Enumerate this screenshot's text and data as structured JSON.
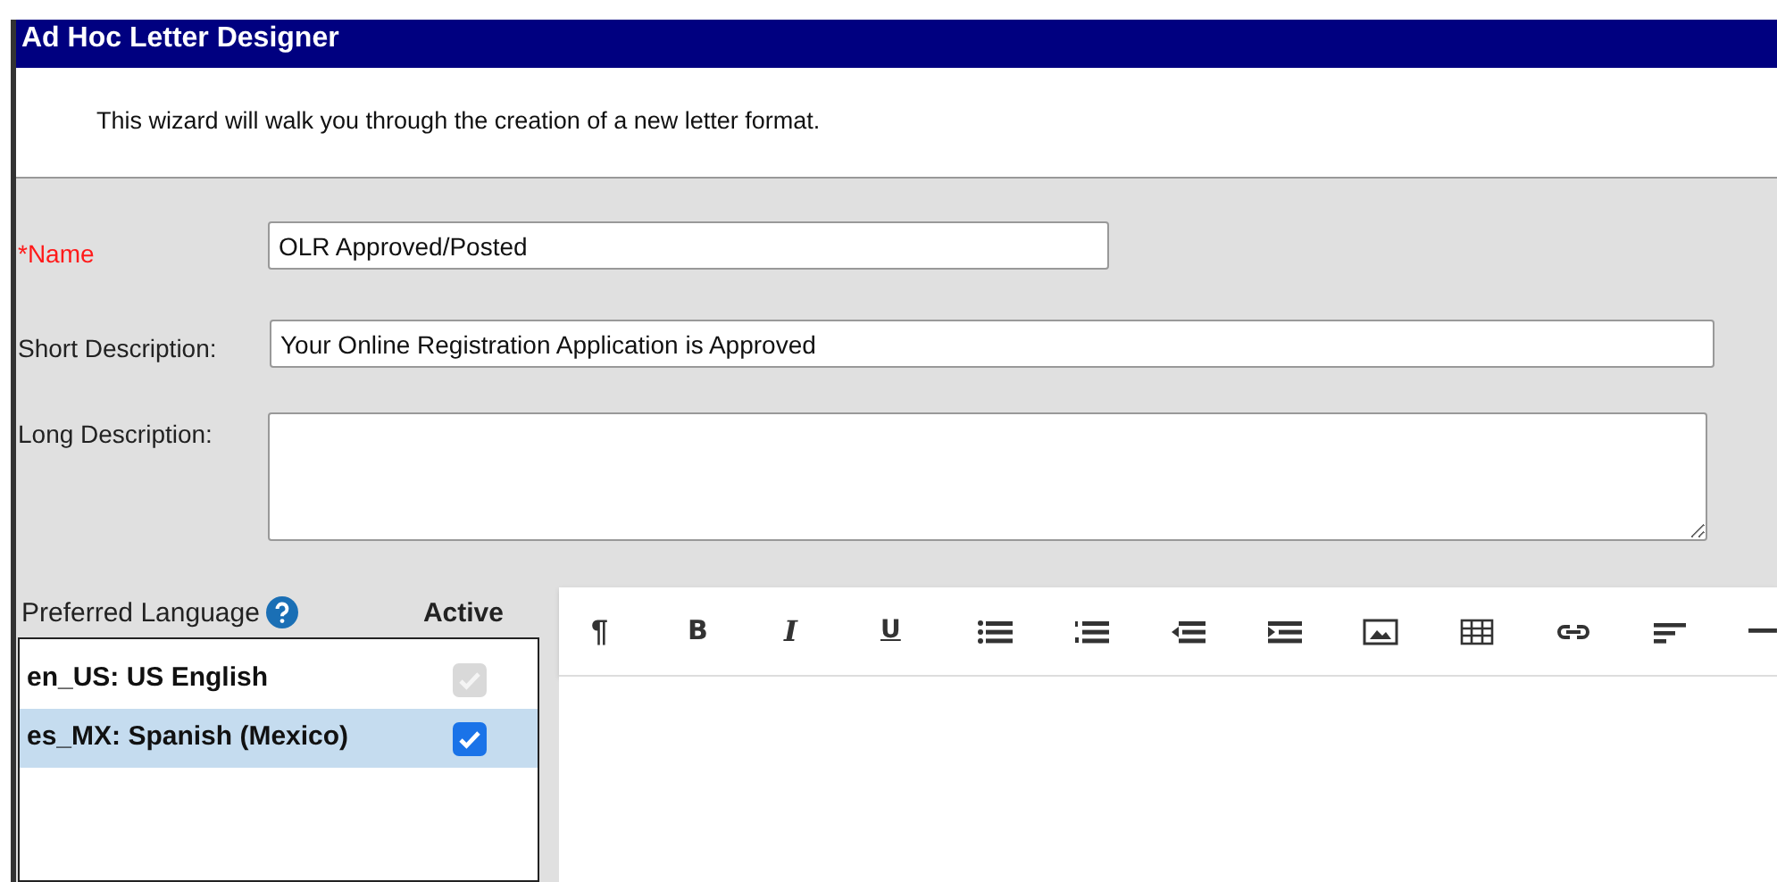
{
  "window": {
    "title": "Ad Hoc Letter Designer"
  },
  "intro": "This wizard will walk you through the creation of a new letter format.",
  "fields": [
    {
      "label": "*Name",
      "required": true,
      "kind": "input",
      "value": "OLR Approved/Posted"
    },
    {
      "label": "Short Description:",
      "required": false,
      "kind": "input",
      "value": "Your Online Registration Application is Approved"
    },
    {
      "label": "Long Description:",
      "required": false,
      "kind": "textarea"
    }
  ],
  "languages": {
    "columns": [
      "Preferred Language",
      "Active"
    ],
    "rows": [
      {
        "label": "en_US: US English",
        "checked": true,
        "disabled": true,
        "selected": false
      },
      {
        "label": "es_MX: Spanish (Mexico)",
        "checked": true,
        "disabled": false,
        "selected": true
      }
    ]
  },
  "editor": {
    "text_buttons": [
      "¶",
      "B",
      "I",
      "U"
    ]
  }
}
